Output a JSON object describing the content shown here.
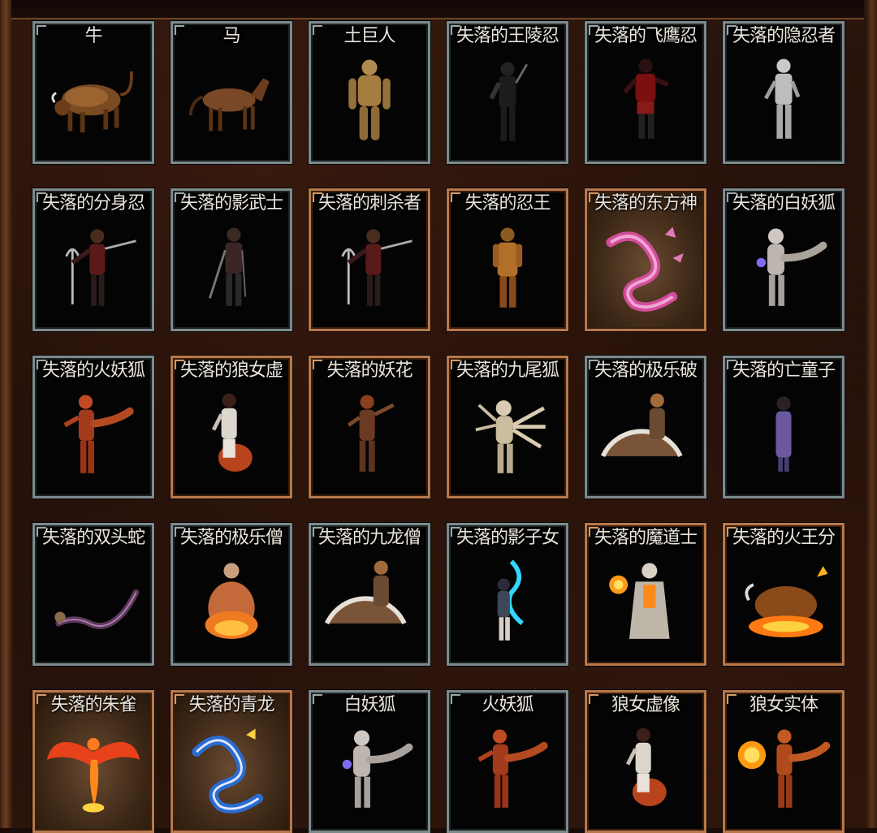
{
  "colors": {
    "border_silver": "#7d8a8c",
    "border_gold": "#b9784a",
    "label_text": "#e9e4dc",
    "panel_bg": "#1f0e08"
  },
  "cards": [
    {
      "name": "牛",
      "icon": "ox-icon",
      "frame": "silver",
      "art": "ox"
    },
    {
      "name": "马",
      "icon": "horse-icon",
      "frame": "silver",
      "art": "horse"
    },
    {
      "name": "土巨人",
      "icon": "earth-giant-icon",
      "frame": "silver",
      "art": "giant"
    },
    {
      "name": "失落的王陵忍",
      "icon": "ninja-icon",
      "frame": "silver",
      "art": "ninja-dark"
    },
    {
      "name": "失落的飞鹰忍",
      "icon": "ninja-icon",
      "frame": "silver",
      "art": "ninja-red"
    },
    {
      "name": "失落的隐忍者",
      "icon": "ninja-icon",
      "frame": "silver",
      "art": "ninja-white"
    },
    {
      "name": "失落的分身忍",
      "icon": "ninja-trident-icon",
      "frame": "silver",
      "art": "trident"
    },
    {
      "name": "失落的影武士",
      "icon": "samurai-icon",
      "frame": "silver",
      "art": "samurai"
    },
    {
      "name": "失落的刺杀者",
      "icon": "ninja-trident-icon",
      "frame": "gold",
      "art": "trident"
    },
    {
      "name": "失落的忍王",
      "icon": "ninja-king-icon",
      "frame": "gold",
      "art": "ninja-gold"
    },
    {
      "name": "失落的东方神",
      "icon": "eastern-dragon-icon",
      "frame": "gold",
      "art": "pink-dragon",
      "bronze": true
    },
    {
      "name": "失落的白妖狐",
      "icon": "white-fox-icon",
      "frame": "silver",
      "art": "white-fox"
    },
    {
      "name": "失落的火妖狐",
      "icon": "fire-fox-icon",
      "frame": "silver",
      "art": "fire-fox"
    },
    {
      "name": "失落的狼女虚",
      "icon": "wolf-woman-icon",
      "frame": "gold",
      "art": "wolf-woman"
    },
    {
      "name": "失落的妖花",
      "icon": "demon-flower-icon",
      "frame": "gold",
      "art": "demon-flower"
    },
    {
      "name": "失落的九尾狐",
      "icon": "nine-tail-fox-icon",
      "frame": "gold",
      "art": "nine-tail"
    },
    {
      "name": "失落的极乐破",
      "icon": "fan-monk-icon",
      "frame": "silver",
      "art": "fan-monk"
    },
    {
      "name": "失落的亡童子",
      "icon": "ghost-child-icon",
      "frame": "silver",
      "art": "ghost-child"
    },
    {
      "name": "失落的双头蛇",
      "icon": "twin-snake-icon",
      "frame": "silver",
      "art": "snake"
    },
    {
      "name": "失落的极乐僧",
      "icon": "fire-monk-icon",
      "frame": "silver",
      "art": "fire-monk"
    },
    {
      "name": "失落的九龙僧",
      "icon": "fan-monk-icon",
      "frame": "silver",
      "art": "fan-monk"
    },
    {
      "name": "失落的影子女",
      "icon": "shadow-woman-icon",
      "frame": "silver",
      "art": "shadow-woman"
    },
    {
      "name": "失落的魔道士",
      "icon": "sorcerer-icon",
      "frame": "gold",
      "art": "sorcerer"
    },
    {
      "name": "失落的火王分",
      "icon": "fire-beast-icon",
      "frame": "gold",
      "art": "fire-beast"
    },
    {
      "name": "失落的朱雀",
      "icon": "phoenix-icon",
      "frame": "gold",
      "art": "phoenix",
      "bronze": true
    },
    {
      "name": "失落的青龙",
      "icon": "azure-dragon-icon",
      "frame": "gold",
      "art": "blue-dragon",
      "bronze": true
    },
    {
      "name": "白妖狐",
      "icon": "white-fox-icon",
      "frame": "silver",
      "art": "white-fox"
    },
    {
      "name": "火妖狐",
      "icon": "fire-fox-icon",
      "frame": "silver",
      "art": "fire-fox"
    },
    {
      "name": "狼女虚像",
      "icon": "wolf-woman-icon",
      "frame": "gold",
      "art": "wolf-woman"
    },
    {
      "name": "狼女实体",
      "icon": "fire-fox-icon",
      "frame": "gold",
      "art": "fire-fox-orb"
    }
  ]
}
